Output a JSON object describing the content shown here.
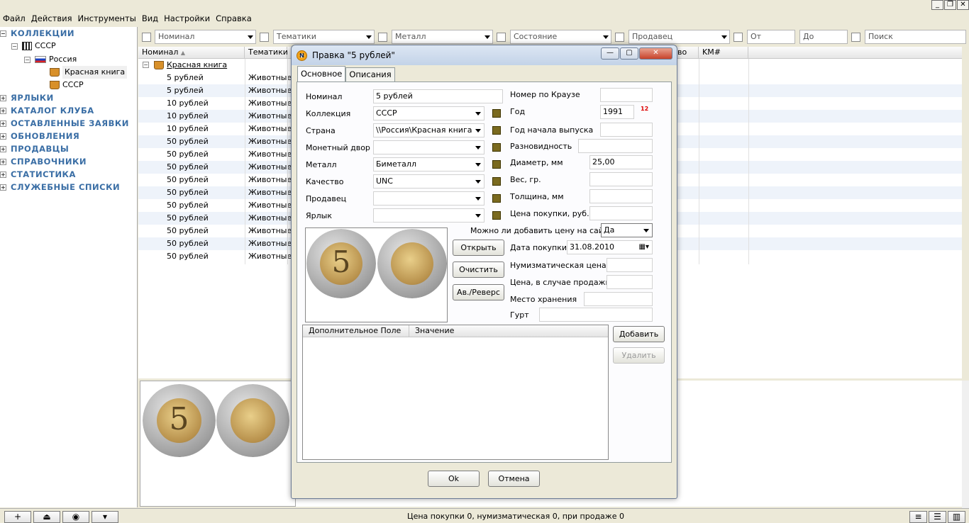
{
  "menu": [
    "Файл",
    "Действия",
    "Инструменты",
    "Вид",
    "Настройки",
    "Справка"
  ],
  "tree": {
    "collections": "КОЛЛЕКЦИИ",
    "ussr": "СССР",
    "russia": "Россия",
    "red_book": "Красная книга",
    "ussr_sub": "СССР",
    "sections": [
      "ЯРЛЫКИ",
      "КАТАЛОГ КЛУБА",
      "ОСТАВЛЕННЫЕ ЗАЯВКИ",
      "ОБНОВЛЕНИЯ",
      "ПРОДАВЦЫ",
      "СПРАВОЧНИКИ",
      "СТАТИСТИКА",
      "СЛУЖЕБНЫЕ СПИСКИ"
    ]
  },
  "filters": {
    "nominal": "Номинал",
    "themes": "Тематики",
    "metal": "Металл",
    "condition": "Состояние",
    "seller": "Продавец",
    "from": "От",
    "to": "До",
    "search": "Поиск"
  },
  "grid": {
    "headers": [
      "Номинал",
      "Тематики",
      "во",
      "KM#"
    ],
    "group": "Красная книга",
    "rows": [
      {
        "nominal": "5 рублей",
        "theme": "Животные"
      },
      {
        "nominal": "5 рублей",
        "theme": "Животные"
      },
      {
        "nominal": "10 рублей",
        "theme": "Животные"
      },
      {
        "nominal": "10 рублей",
        "theme": "Животные"
      },
      {
        "nominal": "10 рублей",
        "theme": "Животные"
      },
      {
        "nominal": "50 рублей",
        "theme": "Животные"
      },
      {
        "nominal": "50 рублей",
        "theme": "Животные"
      },
      {
        "nominal": "50 рублей",
        "theme": "Животные"
      },
      {
        "nominal": "50 рублей",
        "theme": "Животные"
      },
      {
        "nominal": "50 рублей",
        "theme": "Животные"
      },
      {
        "nominal": "50 рублей",
        "theme": "Животные"
      },
      {
        "nominal": "50 рублей",
        "theme": "Животные"
      },
      {
        "nominal": "50 рублей",
        "theme": "Животные"
      },
      {
        "nominal": "50 рублей",
        "theme": "Животные"
      },
      {
        "nominal": "50 рублей",
        "theme": "Животные"
      }
    ]
  },
  "coin_face": "5",
  "status": "Цена покупки 0, нумизматическая 0, при продаже 0",
  "dialog": {
    "title": "Правка \"5 рублей\"",
    "tabs": [
      "Основное",
      "Описания"
    ],
    "labels": {
      "nominal": "Номинал",
      "collection": "Коллекция",
      "country": "Страна",
      "mint": "Монетный двор",
      "metal": "Металл",
      "quality": "Качество",
      "seller": "Продавец",
      "tag": "Ярлык",
      "krause": "Номер по Краузе",
      "year": "Год",
      "year_start": "Год начала выпуска",
      "variety": "Разновидность",
      "diameter": "Диаметр, мм",
      "weight": "Вес, гр.",
      "thickness": "Толщина, мм",
      "price": "Цена покупки, руб.",
      "can_add": "Можно ли добавить цену на сайт?",
      "purchase_date": "Дата покупки",
      "numis_price": "Нумизматическая цена",
      "sale_price": "Цена, в случае продажи",
      "storage": "Место хранения",
      "gurt": "Гурт"
    },
    "values": {
      "nominal": "5 рублей",
      "collection": "СССР",
      "country": "\\\\Россия\\Красная книга",
      "mint": "",
      "metal": "Биметалл",
      "quality": "UNC",
      "seller": "",
      "tag": "",
      "krause": "",
      "year": "1991",
      "year_badge": "12",
      "year_start": "",
      "variety": "",
      "diameter": "25,00",
      "weight": "",
      "thickness": "",
      "price": "",
      "can_add": "Да",
      "purchase_date": "31.08.2010",
      "numis_price": "",
      "sale_price": "",
      "storage": "",
      "gurt": ""
    },
    "buttons": {
      "open": "Открыть",
      "clear": "Очистить",
      "obverse": "Ав./Реверс",
      "add": "Добавить",
      "delete": "Удалить",
      "ok": "Ok",
      "cancel": "Отмена"
    },
    "list_headers": [
      "Дополнительное Поле",
      "Значение"
    ]
  }
}
